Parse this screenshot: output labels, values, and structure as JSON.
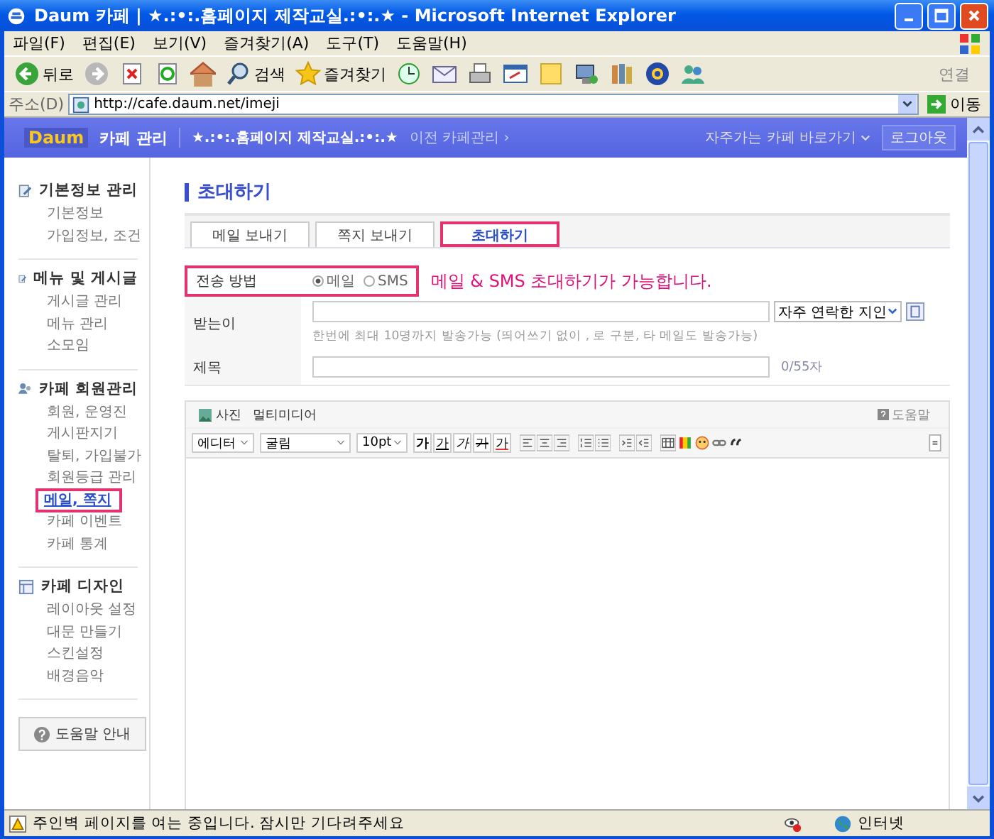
{
  "window": {
    "title": "Daum 카페 | ★.:•:.홈페이지 제작교실.:•:.★ - Microsoft Internet Explorer"
  },
  "menu": [
    "파일(F)",
    "편집(E)",
    "보기(V)",
    "즐겨찾기(A)",
    "도구(T)",
    "도움말(H)"
  ],
  "toolbar": [
    {
      "kind": "back",
      "label": "뒤로"
    },
    {
      "kind": "forward"
    },
    {
      "kind": "stop"
    },
    {
      "kind": "refresh"
    },
    {
      "kind": "home"
    },
    {
      "kind": "search",
      "label": "검색"
    },
    {
      "kind": "favorites",
      "label": "즐겨찾기"
    },
    {
      "kind": "history"
    },
    {
      "kind": "mail"
    },
    {
      "kind": "print"
    },
    {
      "kind": "edit"
    },
    {
      "kind": "note"
    },
    {
      "kind": "messenger"
    },
    {
      "kind": "research"
    },
    {
      "kind": "gear"
    },
    {
      "kind": "people"
    }
  ],
  "links_button": "연결",
  "address": {
    "label": "주소(D)",
    "url": "http://cafe.daum.net/imeji",
    "go": "이동"
  },
  "cafe_header": {
    "logo": "Daum",
    "title": "카페 관리",
    "cafe_name": "★.:•:.홈페이지 제작교실.:•:.★",
    "prev_link": "이전 카페관리 ›",
    "shortcut": "자주가는 카페 바로가기",
    "logout": "로그아웃"
  },
  "sidebar": {
    "groups": [
      {
        "title": "기본정보 관리",
        "items": [
          {
            "label": "기본정보",
            "selected": false
          },
          {
            "label": "가입정보, 조건",
            "selected": false
          }
        ]
      },
      {
        "title": "메뉴 및 게시글",
        "items": [
          {
            "label": "게시글 관리",
            "selected": false
          },
          {
            "label": "메뉴 관리",
            "selected": false
          },
          {
            "label": "소모임",
            "selected": false
          }
        ]
      },
      {
        "title": "카페 회원관리",
        "items": [
          {
            "label": "회원, 운영진",
            "selected": false
          },
          {
            "label": "게시판지기",
            "selected": false
          },
          {
            "label": "탈퇴, 가입불가",
            "selected": false
          },
          {
            "label": "회원등급 관리",
            "selected": false
          },
          {
            "label": "메일, 쪽지",
            "selected": true
          },
          {
            "label": "카페 이벤트",
            "selected": false
          },
          {
            "label": "카페 통계",
            "selected": false
          }
        ]
      },
      {
        "title": "카페 디자인",
        "items": [
          {
            "label": "레이아웃 설정",
            "selected": false
          },
          {
            "label": "대문 만들기",
            "selected": false
          },
          {
            "label": "스킨설정",
            "selected": false
          },
          {
            "label": "배경음악",
            "selected": false
          }
        ]
      }
    ],
    "help_button": "도움말 안내"
  },
  "content": {
    "heading": "초대하기",
    "tabs": [
      {
        "label": "메일 보내기",
        "selected": false
      },
      {
        "label": "쪽지 보내기",
        "selected": false
      },
      {
        "label": "초대하기",
        "selected": true
      }
    ],
    "send_method": {
      "label": "전송 방법",
      "highlighted": true,
      "options": [
        {
          "label": "메일",
          "selected": true
        },
        {
          "label": "SMS",
          "selected": false
        }
      ]
    },
    "annotation": "메일 & SMS 초대하기가 가능합니다.",
    "recipients": {
      "label": "받는이",
      "contacts": "자주 연락한 지인",
      "hint": "한번에 최대 10명까지 발송가능 (띄어쓰기 없이 , 로 구분, 타 메일도 발송가능)"
    },
    "subject": {
      "label": "제목",
      "counter": "0/55자"
    },
    "editor": {
      "attachments": [
        {
          "kind": "photo",
          "label": "사진"
        },
        {
          "kind": "media",
          "label": "멀티미디어"
        }
      ],
      "help": "도움말",
      "dropdowns": [
        "에디터",
        "굴림",
        "10pt"
      ],
      "format": [
        {
          "kind": "bold",
          "label": "가"
        },
        {
          "kind": "underline",
          "label": "가"
        },
        {
          "kind": "italic",
          "label": "가"
        },
        {
          "kind": "strike",
          "label": "가"
        },
        {
          "kind": "color",
          "label": "가"
        }
      ]
    }
  },
  "status_bar": {
    "text": "주인벽 페이지를 여는 중입니다. 잠시만 기다려주세요",
    "zone": "인터넷"
  }
}
